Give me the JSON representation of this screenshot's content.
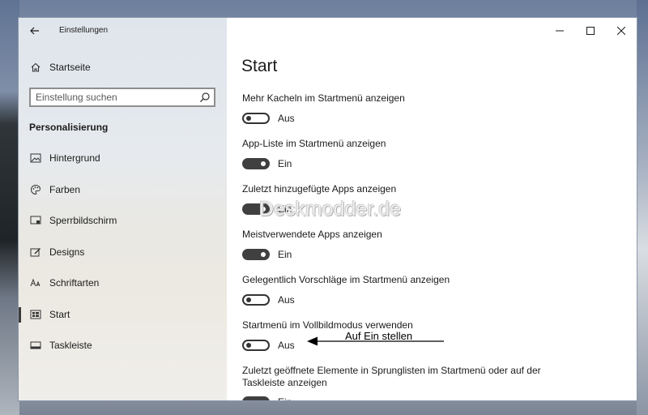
{
  "window": {
    "title": "Einstellungen",
    "back_icon": "back-arrow-icon",
    "controls": [
      "minimize-icon",
      "maximize-icon",
      "close-icon"
    ]
  },
  "sidebar": {
    "home_label": "Startseite",
    "search_placeholder": "Einstellung suchen",
    "section_title": "Personalisierung",
    "items": [
      {
        "label": "Hintergrund",
        "icon": "picture-icon",
        "selected": false
      },
      {
        "label": "Farben",
        "icon": "palette-icon",
        "selected": false
      },
      {
        "label": "Sperrbildschirm",
        "icon": "lock-screen-icon",
        "selected": false
      },
      {
        "label": "Designs",
        "icon": "brush-icon",
        "selected": false
      },
      {
        "label": "Schriftarten",
        "icon": "font-icon",
        "selected": false
      },
      {
        "label": "Start",
        "icon": "start-menu-icon",
        "selected": true
      },
      {
        "label": "Taskleiste",
        "icon": "taskbar-icon",
        "selected": false
      }
    ]
  },
  "main": {
    "page_title": "Start",
    "settings": [
      {
        "label": "Mehr Kacheln im Startmenü anzeigen",
        "state": "Aus",
        "on": false
      },
      {
        "label": "App-Liste im Startmenü anzeigen",
        "state": "Ein",
        "on": true
      },
      {
        "label": "Zuletzt hinzugefügte Apps anzeigen",
        "state": "Ein",
        "on": true
      },
      {
        "label": "Meistverwendete Apps anzeigen",
        "state": "Ein",
        "on": true
      },
      {
        "label": "Gelegentlich Vorschläge im Startmenü anzeigen",
        "state": "Aus",
        "on": false
      },
      {
        "label": "Startmenü im Vollbildmodus verwenden",
        "state": "Aus",
        "on": false
      },
      {
        "label": "Zuletzt geöffnete Elemente in Sprunglisten im Startmenü oder auf der Taskleiste anzeigen",
        "state": "Ein",
        "on": true
      }
    ]
  },
  "watermark": "Deskmodder.de",
  "annotation": "Auf Ein stellen"
}
